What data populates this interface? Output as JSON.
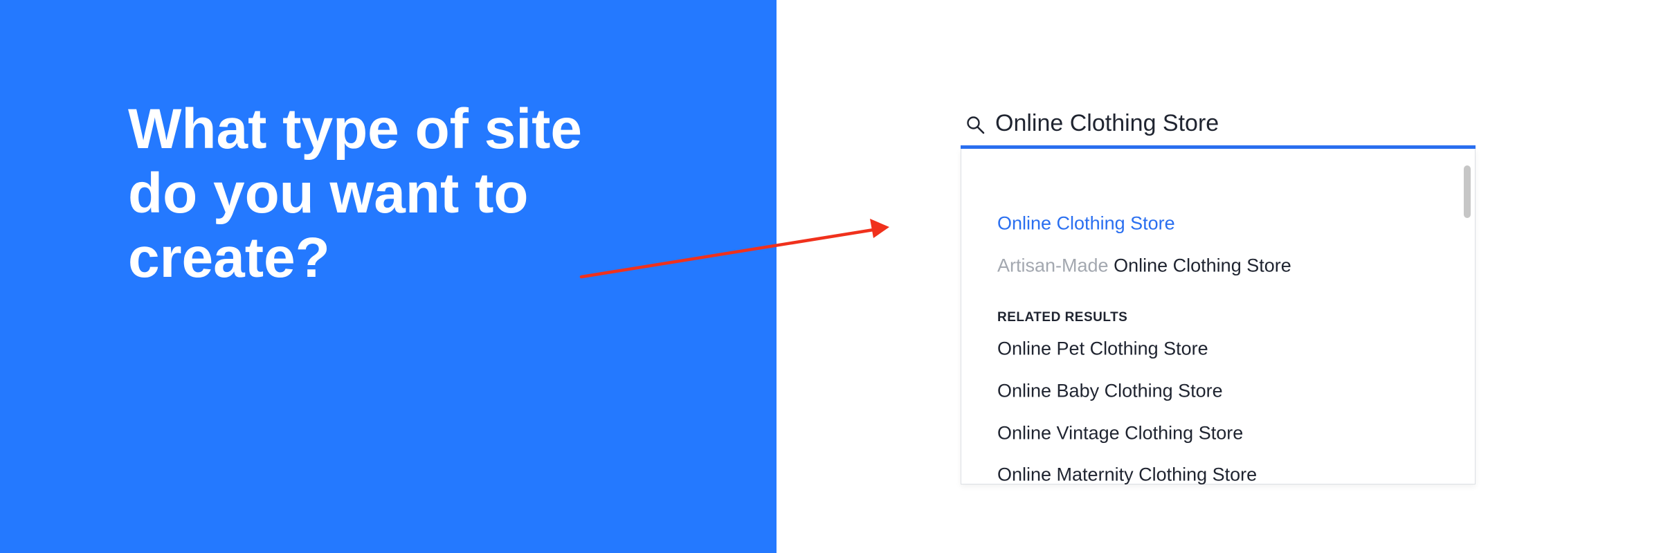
{
  "headline": {
    "lines": [
      "What type of site",
      "do you want to",
      "create?"
    ]
  },
  "colors": {
    "panel_blue": "#2479ff",
    "accent_blue": "#2a6ff0",
    "arrow_red": "#f0311c",
    "muted_gray": "#a3a8b0",
    "text_dark": "#1f2430"
  },
  "search": {
    "icon": "search-icon",
    "value": "Online Clothing Store"
  },
  "suggestions": [
    {
      "label": "Online Clothing Store",
      "active": true
    },
    {
      "prefix": "Artisan-Made",
      "label": "Online Clothing Store",
      "active": false
    }
  ],
  "related": {
    "heading": "RELATED RESULTS",
    "items": [
      "Online Pet Clothing Store",
      "Online Baby Clothing Store",
      "Online Vintage Clothing Store",
      "Online Maternity Clothing Store"
    ]
  }
}
